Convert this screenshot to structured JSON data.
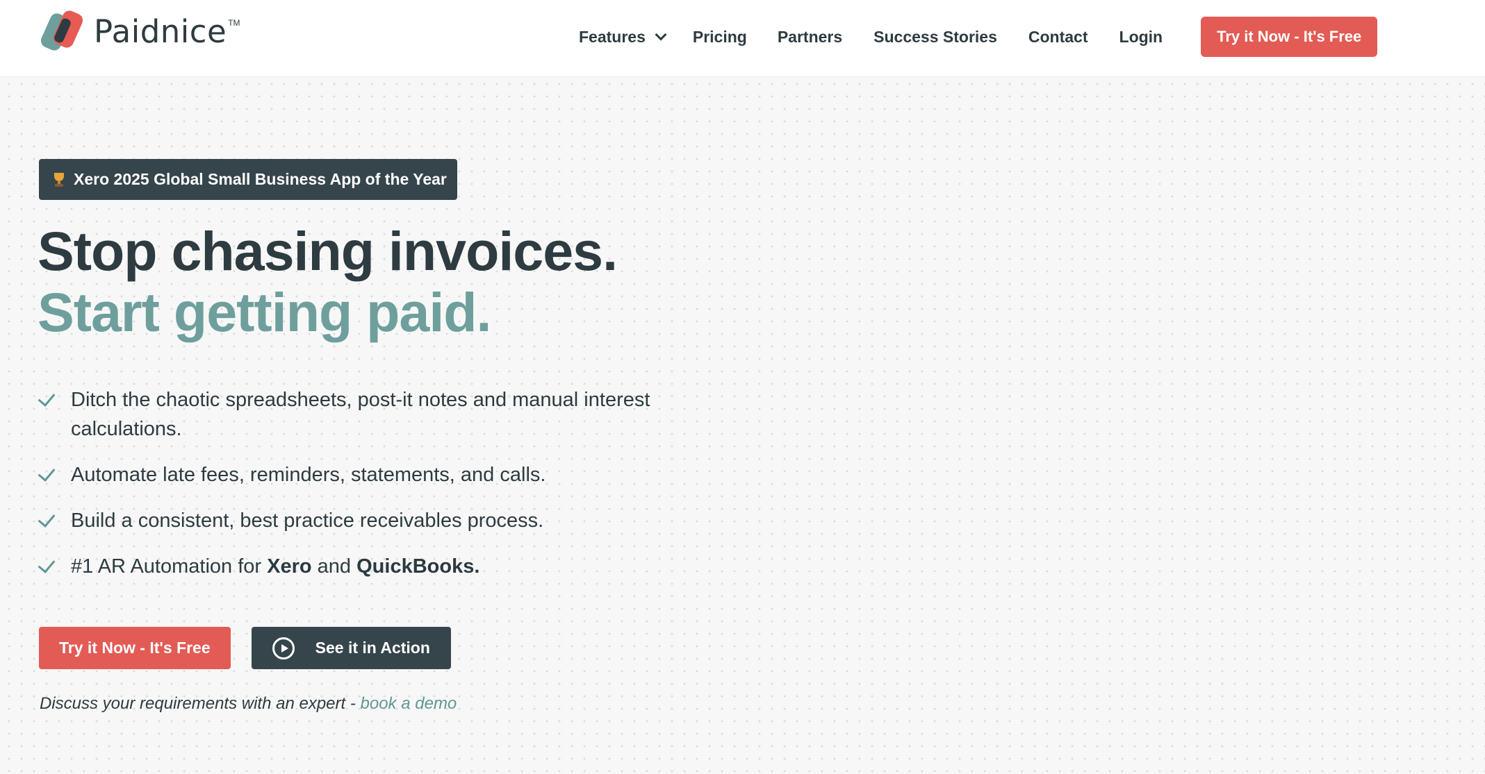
{
  "brand": {
    "name": "Paidnice",
    "trademark": "TM"
  },
  "nav": {
    "items": [
      {
        "label": "Features",
        "has_dropdown": true
      },
      {
        "label": "Pricing"
      },
      {
        "label": "Partners"
      },
      {
        "label": "Success Stories"
      },
      {
        "label": "Contact"
      },
      {
        "label": "Login"
      }
    ],
    "cta_label": "Try it Now - It's Free"
  },
  "hero": {
    "badge": "Xero 2025 Global Small Business App of the Year",
    "badge_icon": "trophy-icon",
    "headline_line1": "Stop chasing invoices.",
    "headline_line2": "Start getting paid.",
    "bullets": [
      {
        "text": "Ditch the chaotic spreadsheets, post-it notes and manual interest calculations."
      },
      {
        "text": "Automate late fees, reminders, statements, and calls."
      },
      {
        "text": "Build a consistent, best practice receivables process."
      },
      {
        "prefix": "#1 AR Automation for ",
        "bold1": "Xero",
        "middle": " and ",
        "bold2": "QuickBooks."
      }
    ],
    "primary_button": "Try it Now - It's Free",
    "secondary_button": "See it in Action",
    "demo_text": "Discuss your requirements with an expert - ",
    "demo_link": "book a demo"
  },
  "colors": {
    "accent_red": "#e35b55",
    "accent_teal": "#6e9f9c",
    "dark": "#36454c",
    "text": "#2e3b40"
  }
}
